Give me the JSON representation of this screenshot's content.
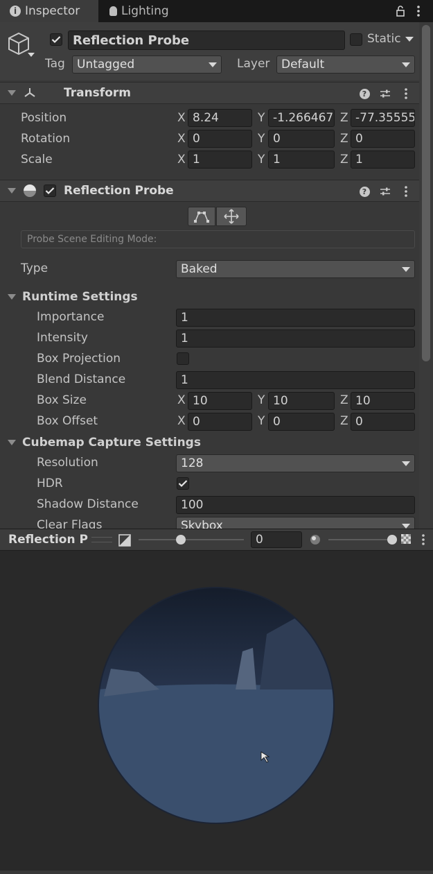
{
  "tabs": [
    {
      "label": "Inspector",
      "icon": "info-icon",
      "active": true
    },
    {
      "label": "Lighting",
      "icon": "light-bulb-icon",
      "active": false
    }
  ],
  "object": {
    "name": "Reflection Probe",
    "active_checked": true,
    "static_label": "Static",
    "static_checked": false,
    "tag_label": "Tag",
    "tag_value": "Untagged",
    "layer_label": "Layer",
    "layer_value": "Default"
  },
  "transform": {
    "title": "Transform",
    "position_label": "Position",
    "rotation_label": "Rotation",
    "scale_label": "Scale",
    "position": {
      "x": "8.24",
      "y": "-1.266467",
      "z": "-77.35555"
    },
    "rotation": {
      "x": "0",
      "y": "0",
      "z": "0"
    },
    "scale": {
      "x": "1",
      "y": "1",
      "z": "1"
    }
  },
  "axis_labels": {
    "x": "X",
    "y": "Y",
    "z": "Z"
  },
  "probe": {
    "title": "Reflection Probe",
    "enabled_checked": true,
    "editing_mode_text": "Probe Scene Editing Mode:",
    "type_label": "Type",
    "type_value": "Baked",
    "runtime": {
      "title": "Runtime Settings",
      "importance_label": "Importance",
      "importance": "1",
      "intensity_label": "Intensity",
      "intensity": "1",
      "box_projection_label": "Box Projection",
      "box_projection_checked": false,
      "blend_distance_label": "Blend Distance",
      "blend_distance": "1",
      "box_size_label": "Box Size",
      "box_size": {
        "x": "10",
        "y": "10",
        "z": "10"
      },
      "box_offset_label": "Box Offset",
      "box_offset": {
        "x": "0",
        "y": "0",
        "z": "0"
      }
    },
    "capture": {
      "title": "Cubemap Capture Settings",
      "resolution_label": "Resolution",
      "resolution": "128",
      "hdr_label": "HDR",
      "hdr_checked": true,
      "shadow_distance_label": "Shadow Distance",
      "shadow_distance": "100",
      "clear_flags_label": "Clear Flags",
      "clear_flags": "Skybox"
    }
  },
  "preview": {
    "title": "Reflection P",
    "exposure_value": "0",
    "exposure_slider": 0.4,
    "mip_slider": 1.0
  },
  "colors": {
    "accent": "#3a79bb",
    "sphere": "#34465f"
  }
}
